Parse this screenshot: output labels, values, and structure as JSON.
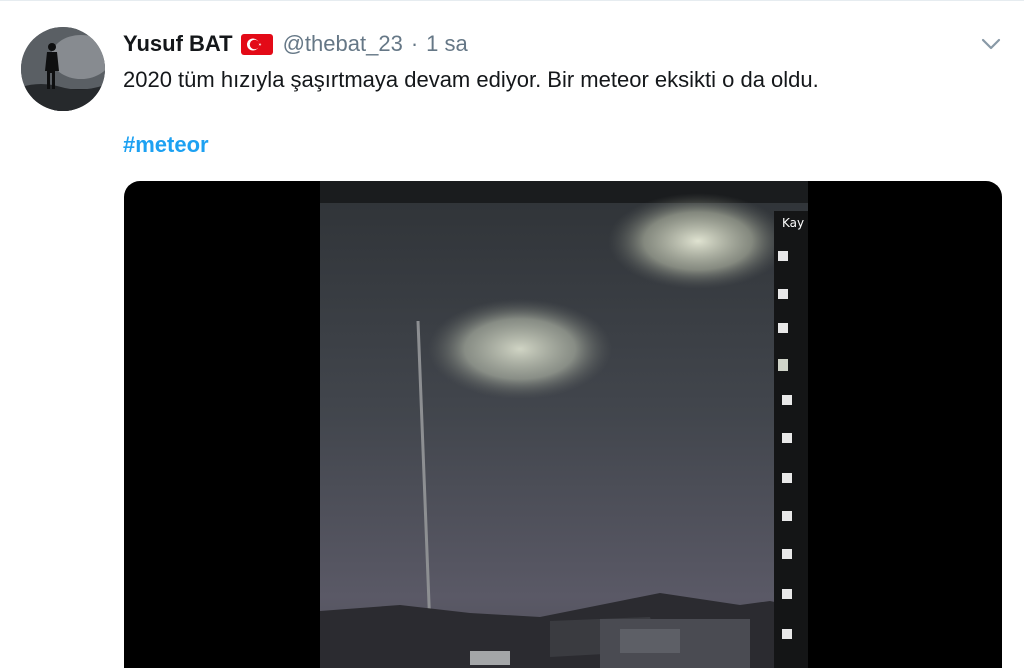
{
  "tweet": {
    "author": {
      "display_name": "Yusuf BAT",
      "flag_icon": "turkey-flag-icon",
      "handle": "@thebat_23",
      "separator": "·",
      "time": "1 sa"
    },
    "text": "2020 tüm hızıyla şaşırtmaya devam ediyor. Bir meteor eksikti o da oldu.",
    "hashtag": "#meteor",
    "menu_icon": "chevron-down-icon",
    "media": {
      "type": "video",
      "overlay_text": "Kay"
    }
  },
  "colors": {
    "text": "#14171a",
    "secondary": "#657786",
    "link": "#1da1f2",
    "flag_red": "#e30a17"
  }
}
